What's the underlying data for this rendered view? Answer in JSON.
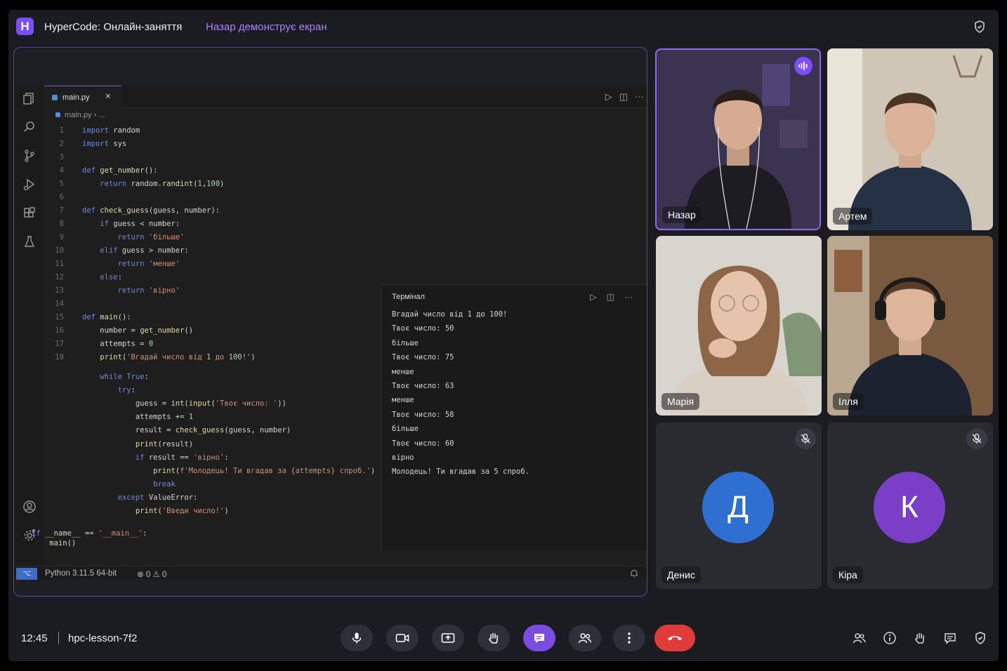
{
  "app": {
    "logo_letter": "H",
    "title": "HyperCode: Онлайн-заняття",
    "presenting": "Назар демонструє екран"
  },
  "editor": {
    "tab_label": "main.py",
    "tab_close": "×",
    "breadcrumb": "main.py › ...",
    "code_lines": [
      {
        "n": "1",
        "t": "import random"
      },
      {
        "n": "2",
        "t": "import sys"
      },
      {
        "n": "3",
        "t": ""
      },
      {
        "n": "4",
        "t": "def get_number():"
      },
      {
        "n": "5",
        "t": "    return random.randint(1,100)"
      },
      {
        "n": "6",
        "t": ""
      },
      {
        "n": "7",
        "t": "def check_guess(guess, number):"
      },
      {
        "n": "8",
        "t": "    if guess < number:"
      },
      {
        "n": "9",
        "t": "        return 'більше'"
      },
      {
        "n": "10",
        "t": "    elif guess > number:"
      },
      {
        "n": "11",
        "t": "        return 'менше'"
      },
      {
        "n": "12",
        "t": "    else:"
      },
      {
        "n": "13",
        "t": "        return 'вірно'"
      },
      {
        "n": "14",
        "t": ""
      },
      {
        "n": "15",
        "t": "def main():"
      },
      {
        "n": "16",
        "t": "    number = get_number()"
      },
      {
        "n": "17",
        "t": "    attempts = 0"
      },
      {
        "n": "18",
        "t": "    print('Вгадай число від 1 до 100!')"
      },
      {
        "n": "",
        "t": "    while True:"
      },
      {
        "n": "",
        "t": "        try:"
      },
      {
        "n": "",
        "t": "            guess = int(input('Твоє число: '))"
      },
      {
        "n": "",
        "t": "            attempts += 1"
      },
      {
        "n": "",
        "t": "            result = check_guess(guess, number)"
      },
      {
        "n": "",
        "t": "            print(result)"
      },
      {
        "n": "",
        "t": "            if result == 'вірно':"
      },
      {
        "n": "",
        "t": "                print(f'Молодець! Ти вгадав за {attempts} спроб.')"
      },
      {
        "n": "",
        "t": "                break"
      },
      {
        "n": "",
        "t": "        except ValueError:"
      },
      {
        "n": "",
        "t": "            print('Введи число!')"
      },
      {
        "n": "",
        "t": "if __name__ == '__main__':"
      },
      {
        "n": "",
        "t": "    main()"
      }
    ],
    "terminal": {
      "title": "Термінал",
      "lines": [
        "Вгадай число від 1 до 100!",
        "Твоє число: 50",
        "більше",
        "Твоє число: 75",
        "менше",
        "Твоє число: 63",
        "менше",
        "Твоє число: 58",
        "більше",
        "Твоє число: 60",
        "вірно",
        "Молодець! Ти вгадав за 5 спроб."
      ]
    },
    "status": {
      "interpreter": "Python 3.11.5 64-bit",
      "problems": "⊗ 0  ⚠ 0"
    }
  },
  "participants": [
    {
      "name": "Назар",
      "speaking": true
    },
    {
      "name": "Артем"
    },
    {
      "name": "Марія"
    },
    {
      "name": "Ілля"
    },
    {
      "name": "Денис",
      "initial": "Д",
      "color": "#2f6fd1",
      "muted": true
    },
    {
      "name": "Кіра",
      "initial": "К",
      "color": "#7a3fc6",
      "muted": true
    }
  ],
  "bottom": {
    "time": "12:45",
    "room_code": "hpc-lesson-7f2"
  },
  "colors": {
    "accent": "#7c4dff",
    "hangup": "#e03b3b"
  }
}
